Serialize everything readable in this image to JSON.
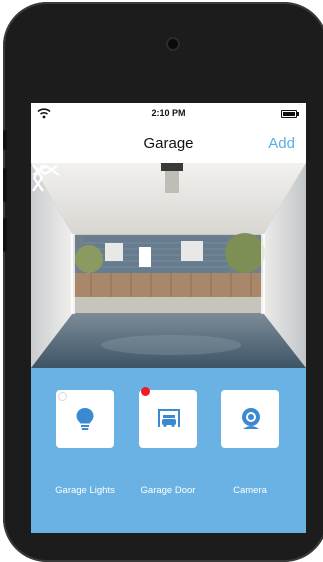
{
  "status_bar": {
    "time": "2:10 PM"
  },
  "nav": {
    "title": "Garage",
    "add_label": "Add"
  },
  "camera_feed": {
    "scene": "garage-camera-view"
  },
  "devices": [
    {
      "label": "Garage Lights",
      "icon": "lightbulb-icon"
    },
    {
      "label": "Garage Door",
      "icon": "garage-door-icon",
      "alert": true
    },
    {
      "label": "Camera",
      "icon": "camera-icon"
    }
  ],
  "colors": {
    "accent": "#5aaee2",
    "panel": "#69b2e3",
    "icon": "#3b8ad1",
    "alert": "#ee1d24"
  }
}
